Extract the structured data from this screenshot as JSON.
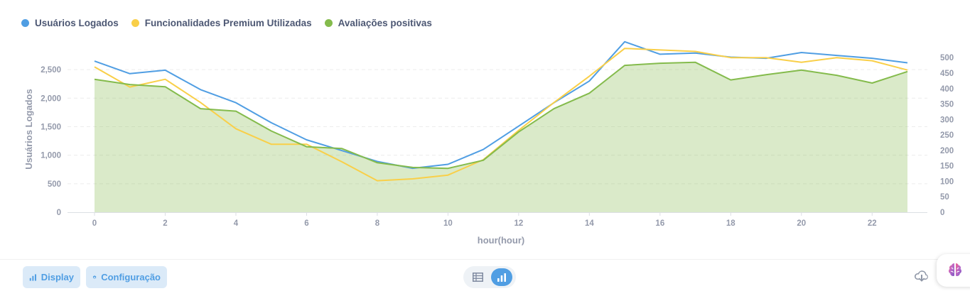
{
  "chart_data": {
    "type": "line",
    "x": [
      0,
      1,
      2,
      3,
      4,
      5,
      6,
      7,
      8,
      9,
      10,
      11,
      12,
      13,
      14,
      15,
      16,
      17,
      18,
      19,
      20,
      21,
      22,
      23
    ],
    "xticks": [
      0,
      2,
      4,
      6,
      8,
      10,
      12,
      14,
      16,
      18,
      20,
      22
    ],
    "xlabel": "hour(hour)",
    "ylabel": "Usuários Logados",
    "ylim_left": [
      0,
      2900
    ],
    "yticks_left": [
      "0",
      "500",
      "1,000",
      "1,500",
      "2,000",
      "2,500"
    ],
    "ylim_right": [
      0,
      535
    ],
    "yticks_right": [
      "0",
      "50",
      "100",
      "150",
      "200",
      "250",
      "300",
      "350",
      "400",
      "450",
      "500"
    ],
    "series": [
      {
        "name": "Usuários Logados",
        "axis": "left",
        "style": "line",
        "color": "#509ee3",
        "values": [
          2650,
          2430,
          2490,
          2150,
          1920,
          1570,
          1270,
          1080,
          890,
          770,
          840,
          1100,
          1510,
          1920,
          2300,
          2990,
          2770,
          2790,
          2720,
          2700,
          2800,
          2750,
          2700,
          2620
        ]
      },
      {
        "name": "Funcionalidades Premium Utilizadas",
        "axis": "right",
        "style": "line",
        "color": "#f9cf48",
        "values": [
          470,
          405,
          430,
          355,
          270,
          220,
          220,
          163,
          102,
          108,
          120,
          170,
          265,
          355,
          440,
          530,
          525,
          520,
          500,
          500,
          485,
          500,
          490,
          460
        ]
      },
      {
        "name": "Avaliações positivas",
        "axis": "right",
        "style": "area",
        "color": "#84bb4c",
        "values": [
          430,
          413,
          406,
          335,
          327,
          263,
          212,
          206,
          160,
          145,
          142,
          168,
          260,
          335,
          385,
          475,
          482,
          485,
          428,
          445,
          460,
          443,
          418,
          455
        ]
      }
    ]
  },
  "footer": {
    "display_label": "Display",
    "config_label": "Configuração"
  },
  "icons": {
    "display": "bar-chart-icon",
    "config": "gear-icon",
    "table": "table-icon",
    "chart": "bar-chart-icon",
    "download": "cloud-download-icon",
    "assistant": "brain-icon"
  }
}
